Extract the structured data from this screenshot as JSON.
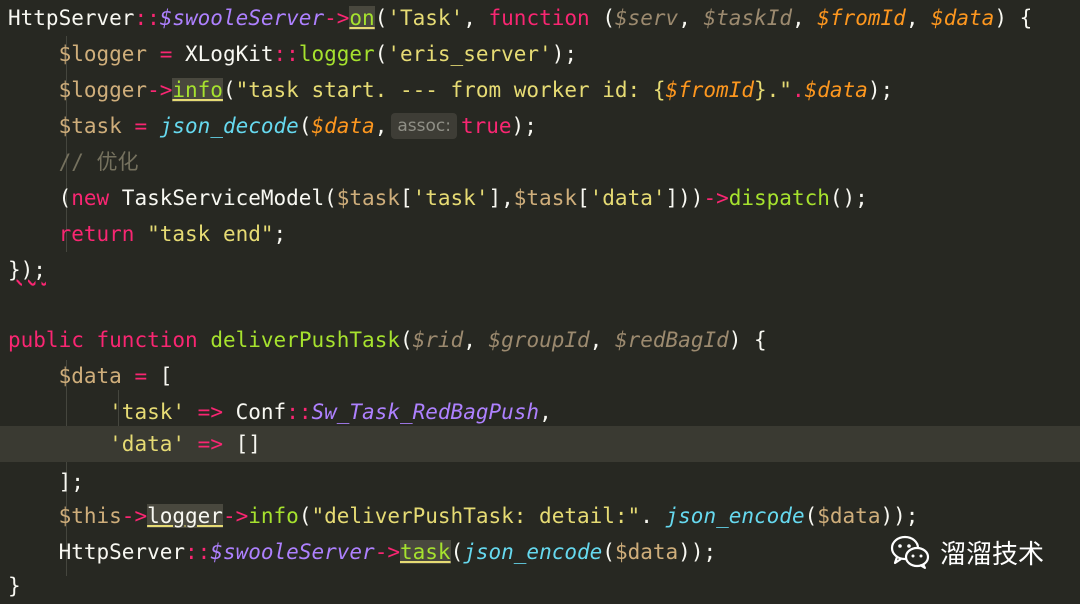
{
  "code": {
    "l1": {
      "a": "HttpServer",
      "b": "::",
      "c": "$swooleServer",
      "d": "->",
      "e": "on",
      "f": "(",
      "g": "'Task'",
      "h": ", ",
      "i": "function",
      "j": " (",
      "k": "$serv",
      "l": ", ",
      "m": "$taskId",
      "n": ", ",
      "o": "$fromId",
      "p": ", ",
      "q": "$data",
      "r": ") {"
    },
    "l2": {
      "a": "    $logger ",
      "b": "=",
      "c": " XLogKit",
      "d": "::",
      "e": "logger",
      "f": "(",
      "g": "'eris_server'",
      "h": ");"
    },
    "l3": {
      "a": "    $logger",
      "b": "->",
      "c": "info",
      "d": "(",
      "e": "\"task start. --- from worker id: {",
      "f": "$fromId",
      "g": "}.\"",
      "h": ".",
      "i": "$data",
      "j": ");"
    },
    "l4": {
      "a": "    $task ",
      "b": "=",
      "c": " ",
      "d": "json_decode",
      "e": "(",
      "f": "$data",
      "g": ",",
      "hint": "assoc:",
      "h": "true",
      "i": ");"
    },
    "l5": {
      "a": "    // 优化"
    },
    "l6": {
      "a": "    (",
      "b": "new",
      "c": " TaskServiceModel(",
      "d": "$task",
      "e": "[",
      "f": "'task'",
      "g": "],",
      "h": "$task",
      "i": "[",
      "j": "'data'",
      "k": "]))",
      "l": "->",
      "m": "dispatch",
      "n": "();"
    },
    "l7": {
      "a": "    ",
      "b": "return",
      "c": " ",
      "d": "\"task end\"",
      "e": ";"
    },
    "l8": {
      "a": "});"
    },
    "l9": {
      "a": ""
    },
    "l10": {
      "a": "public",
      "b": " ",
      "c": "function",
      "d": " ",
      "e": "deliverPushTask",
      "f": "(",
      "g": "$rid",
      "h": ", ",
      "i": "$groupId",
      "j": ", ",
      "k": "$redBagId",
      "l": ") {"
    },
    "l11": {
      "a": "    $data ",
      "b": "=",
      "c": " ["
    },
    "l12": {
      "a": "        ",
      "b": "'task'",
      "c": " ",
      "d": "=>",
      "e": " Conf",
      "f": "::",
      "g": "Sw_Task_RedBagPush",
      "h": ","
    },
    "l13": {
      "a": "        ",
      "b": "'data'",
      "c": " ",
      "d": "=>",
      "e": " []"
    },
    "l14": {
      "a": "    ];"
    },
    "l15": {
      "a": "    $this",
      "b": "->",
      "c": "logger",
      "d": "->",
      "e": "info",
      "f": "(",
      "g": "\"deliverPushTask: detail:\"",
      "h": ". ",
      "i": "json_encode",
      "j": "(",
      "k": "$data",
      "l": "));"
    },
    "l16": {
      "a": "    HttpServer",
      "b": "::",
      "c": "$swooleServer",
      "d": "->",
      "e": "task",
      "f": "(",
      "g": "json_encode",
      "h": "(",
      "i": "$data",
      "j": "));"
    },
    "l17": {
      "a": "}"
    }
  },
  "watermark": {
    "text": "溜溜技术",
    "icon": "wechat-icon"
  },
  "colors": {
    "background": "#272822",
    "keyword": "#f92672",
    "function": "#a6e22e",
    "string": "#e6db74",
    "variable": "#fd971f",
    "comment": "#75715e",
    "active_line": "#3a3a32"
  }
}
